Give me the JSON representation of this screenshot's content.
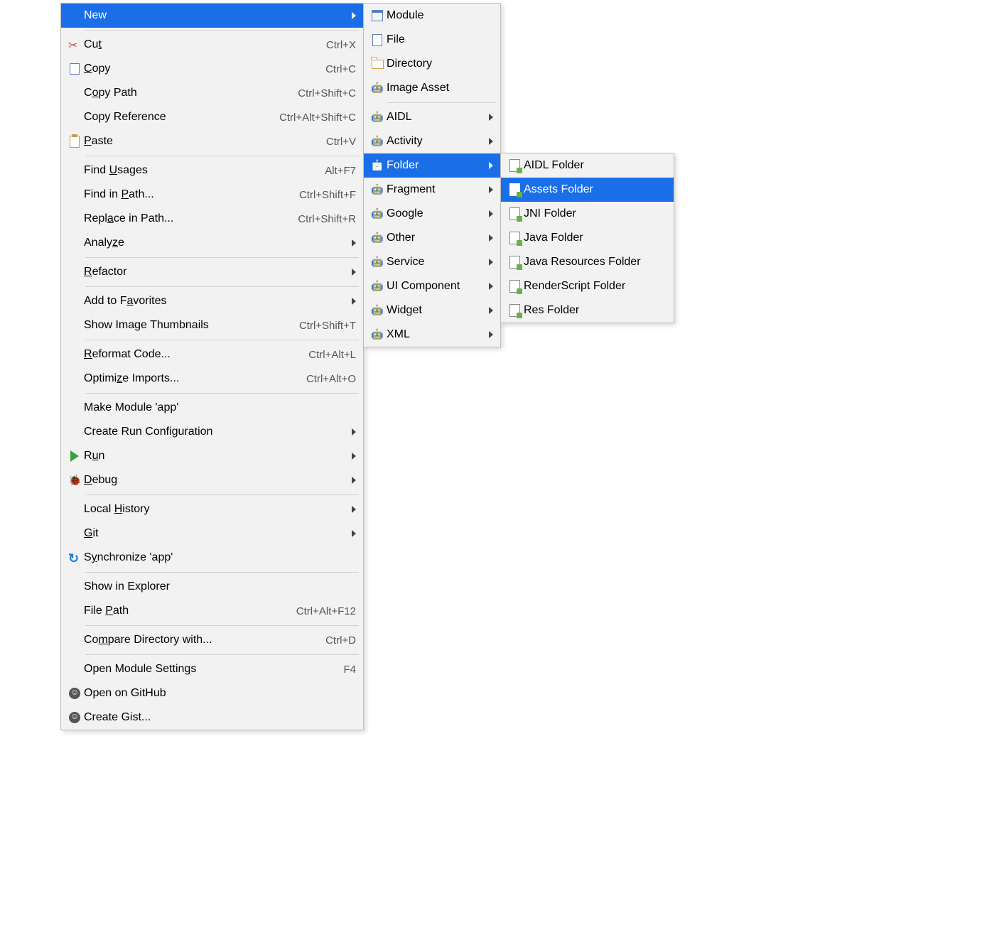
{
  "menu1": {
    "new": "New",
    "cut": "Cut",
    "cut_sc": "Ctrl+X",
    "copy": "Copy",
    "copy_sc": "Ctrl+C",
    "copy_path": "Copy Path",
    "copy_path_sc": "Ctrl+Shift+C",
    "copy_ref": "Copy Reference",
    "copy_ref_sc": "Ctrl+Alt+Shift+C",
    "paste": "Paste",
    "paste_sc": "Ctrl+V",
    "find_usages": "Find Usages",
    "find_usages_sc": "Alt+F7",
    "find_in_path": "Find in Path...",
    "find_in_path_sc": "Ctrl+Shift+F",
    "replace_in_path": "Replace in Path...",
    "replace_in_path_sc": "Ctrl+Shift+R",
    "analyze": "Analyze",
    "refactor": "Refactor",
    "add_fav": "Add to Favorites",
    "show_thumbs": "Show Image Thumbnails",
    "show_thumbs_sc": "Ctrl+Shift+T",
    "reformat": "Reformat Code...",
    "reformat_sc": "Ctrl+Alt+L",
    "optimize": "Optimize Imports...",
    "optimize_sc": "Ctrl+Alt+O",
    "make_module": "Make Module 'app'",
    "create_run": "Create Run Configuration",
    "run": "Run",
    "debug": "Debug",
    "local_history": "Local History",
    "git": "Git",
    "sync": "Synchronize 'app'",
    "show_explorer": "Show in Explorer",
    "file_path": "File Path",
    "file_path_sc": "Ctrl+Alt+F12",
    "compare_dir": "Compare Directory with...",
    "compare_dir_sc": "Ctrl+D",
    "open_module": "Open Module Settings",
    "open_module_sc": "F4",
    "open_github": "Open on GitHub",
    "create_gist": "Create Gist..."
  },
  "menu2": {
    "module": "Module",
    "file": "File",
    "directory": "Directory",
    "image_asset": "Image Asset",
    "aidl": "AIDL",
    "activity": "Activity",
    "folder": "Folder",
    "fragment": "Fragment",
    "google": "Google",
    "other": "Other",
    "service": "Service",
    "ui_component": "UI Component",
    "widget": "Widget",
    "xml": "XML"
  },
  "menu3": {
    "aidl_folder": "AIDL Folder",
    "assets_folder": "Assets Folder",
    "jni_folder": "JNI Folder",
    "java_folder": "Java Folder",
    "java_res_folder": "Java Resources Folder",
    "renderscript_folder": "RenderScript Folder",
    "res_folder": "Res Folder"
  }
}
